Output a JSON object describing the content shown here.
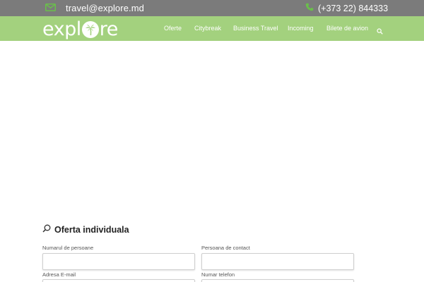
{
  "topbar": {
    "email": "travel@explore.md",
    "phone": "(+373 22) 844333",
    "icon_mail": "envelope-icon",
    "icon_phone": "phone-icon"
  },
  "header": {
    "logo_left": "expl",
    "logo_right": "re",
    "logo_icon": "palm-tree-icon",
    "menu": [
      {
        "label": "Oferte"
      },
      {
        "label": "Citybreak"
      },
      {
        "label": "Business Travel"
      },
      {
        "label": "Incoming"
      },
      {
        "label": "Bilete de avion"
      }
    ],
    "search_icon": "search-icon"
  },
  "form": {
    "title": "Oferta individuala",
    "title_icon": "search-icon",
    "fields": {
      "persons": {
        "label": "Numarul de persoane",
        "value": "",
        "placeholder": ""
      },
      "contact": {
        "label": "Persoana de contact",
        "value": "",
        "placeholder": ""
      },
      "email": {
        "label": "Adresa E-mail",
        "value": "",
        "placeholder": ""
      },
      "phone": {
        "label": "Numar telefon",
        "value": "",
        "placeholder": ""
      }
    }
  },
  "colors": {
    "topbar": "#7b7b7b",
    "nav": "#a3d17e",
    "accent": "#4caf50"
  }
}
